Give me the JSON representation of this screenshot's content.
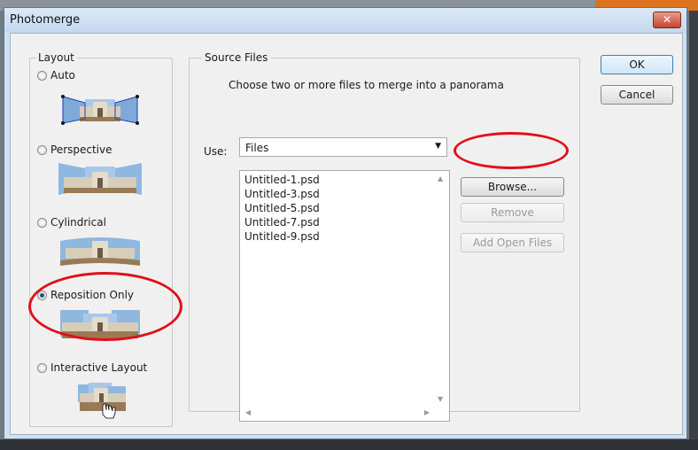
{
  "window": {
    "title": "Photomerge",
    "close_glyph": "✕"
  },
  "layout": {
    "legend": "Layout",
    "options": [
      {
        "label": "Auto",
        "checked": false
      },
      {
        "label": "Perspective",
        "checked": false
      },
      {
        "label": "Cylindrical",
        "checked": false
      },
      {
        "label": "Reposition Only",
        "checked": true
      },
      {
        "label": "Interactive Layout",
        "checked": false
      }
    ]
  },
  "source": {
    "legend": "Source Files",
    "instruction": "Choose two or more files to merge into a panorama",
    "use_label": "Use:",
    "use_value": "Files",
    "files": [
      "Untitled-1.psd",
      "Untitled-3.psd",
      "Untitled-5.psd",
      "Untitled-7.psd",
      "Untitled-9.psd"
    ]
  },
  "buttons": {
    "ok": "OK",
    "cancel": "Cancel",
    "browse": "Browse...",
    "remove": "Remove",
    "add_open_files": "Add Open Files"
  },
  "icons": [
    "close-icon",
    "dropdown-arrow-icon",
    "hand-cursor-icon"
  ],
  "colors": {
    "annotation": "#e0101a",
    "accent": "#3c7fb1"
  }
}
